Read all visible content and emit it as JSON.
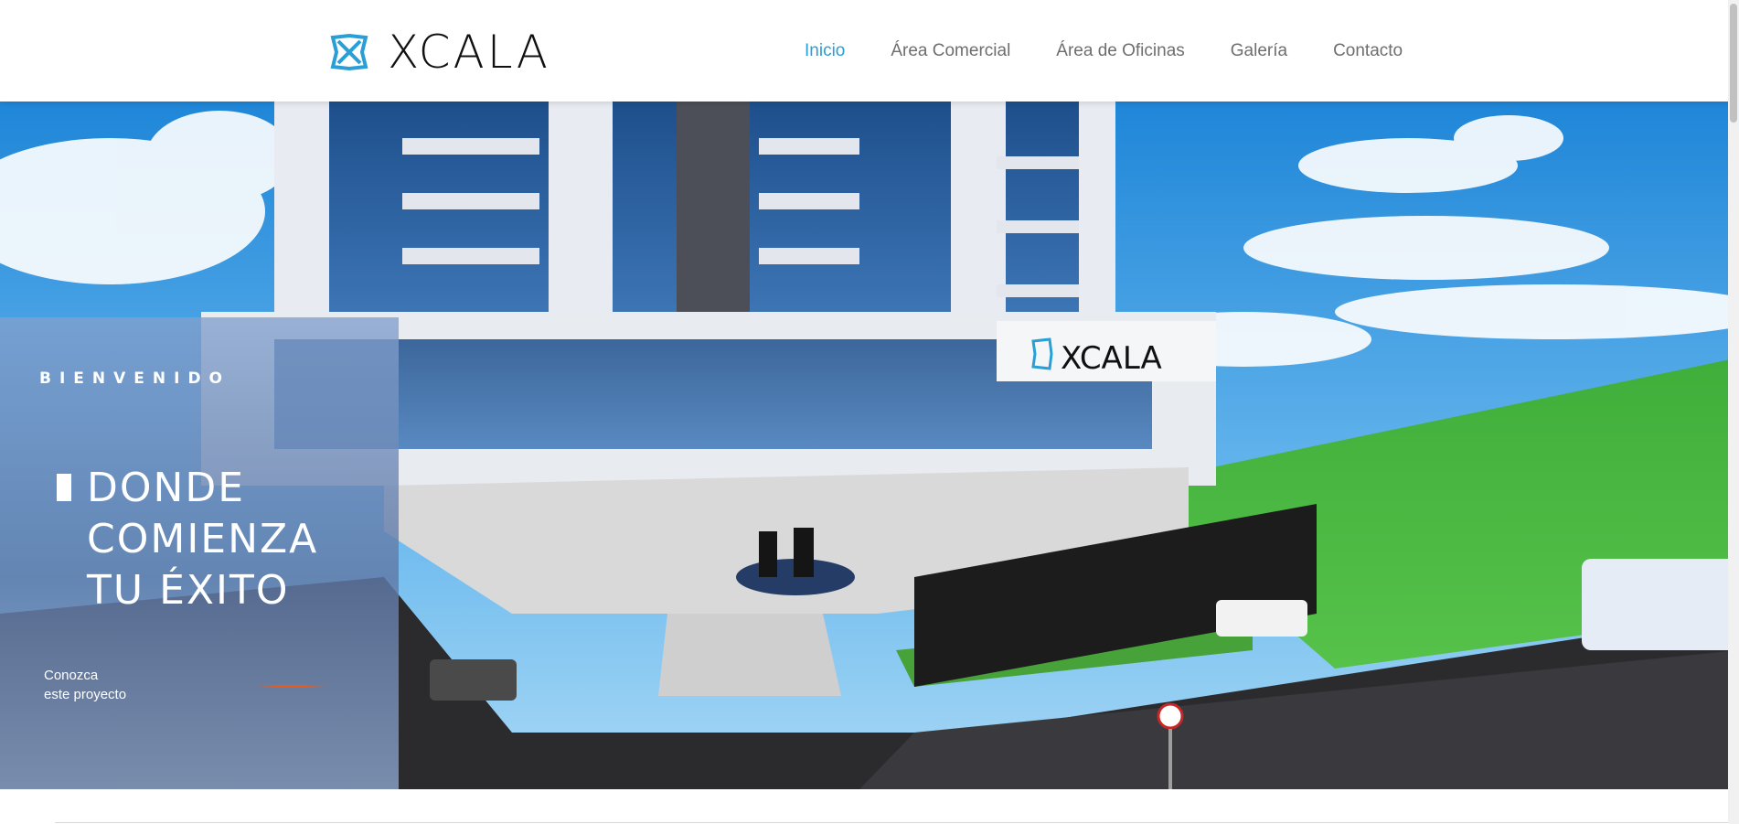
{
  "brand": {
    "name": "XCALA",
    "accent_color": "#2a9fd6",
    "logo_icon": "xcala-logo-icon"
  },
  "nav": {
    "items": [
      {
        "label": "Inicio",
        "active": true
      },
      {
        "label": "Área Comercial",
        "active": false
      },
      {
        "label": "Área de Oficinas",
        "active": false
      },
      {
        "label": "Galería",
        "active": false
      },
      {
        "label": "Contacto",
        "active": false
      }
    ]
  },
  "hero": {
    "welcome": "BIENVENIDO",
    "title_lines": [
      "DONDE",
      "COMIENZA",
      "TU ÉXITO"
    ],
    "cta_lines": [
      "Conozca",
      "este proyecto"
    ],
    "building_sign": "XCALA",
    "background_image": "building-rendering"
  }
}
